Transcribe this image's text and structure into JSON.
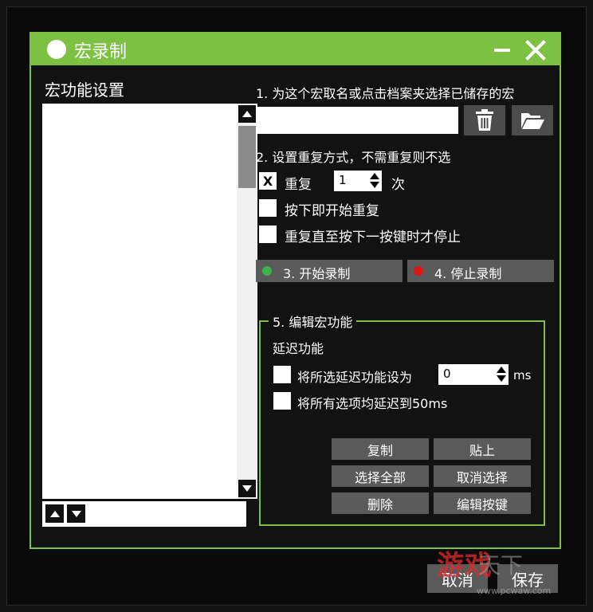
{
  "window": {
    "title": "宏录制"
  },
  "left_panel": {
    "heading": "宏功能设置"
  },
  "step1": {
    "label": "1. 为这个宏取名或点击档案夹选择已储存的宏",
    "name_value": ""
  },
  "step2": {
    "label": "2. 设置重复方式，不需重复则不选",
    "repeat_check": "X",
    "repeat_label": "重复",
    "repeat_count": "1",
    "repeat_unit": "次",
    "hold_label": "按下即开始重复",
    "until_label": "重复直至按下一按键时才停止"
  },
  "step3": {
    "label": "3.  开始录制"
  },
  "step4": {
    "label": "4. 停止录制"
  },
  "step5": {
    "legend": "5. 编辑宏功能",
    "delay_heading": "延迟功能",
    "set_delay_label": "将所选延迟功能设为",
    "delay_value": "0",
    "delay_unit": "ms",
    "all_delay_label": "将所有选项均延迟到50ms",
    "buttons": [
      "复制",
      "贴上",
      "选择全部",
      "取消选择",
      "删除",
      "编辑按键"
    ]
  },
  "footer": {
    "cancel": "取消",
    "save": "保存"
  },
  "watermark": {
    "red": "游戏",
    "gray": "天下",
    "url": "www.pcwaw.com"
  },
  "colors": {
    "accent": "#7cc142",
    "button": "#5a5a5a",
    "start_dot": "#3cb34a",
    "stop_dot": "#e01515"
  },
  "icons": [
    "close-icon",
    "minimize-icon",
    "trash-icon",
    "folder-open-icon",
    "scroll-up-icon",
    "scroll-down-icon",
    "move-up-icon",
    "move-down-icon"
  ]
}
